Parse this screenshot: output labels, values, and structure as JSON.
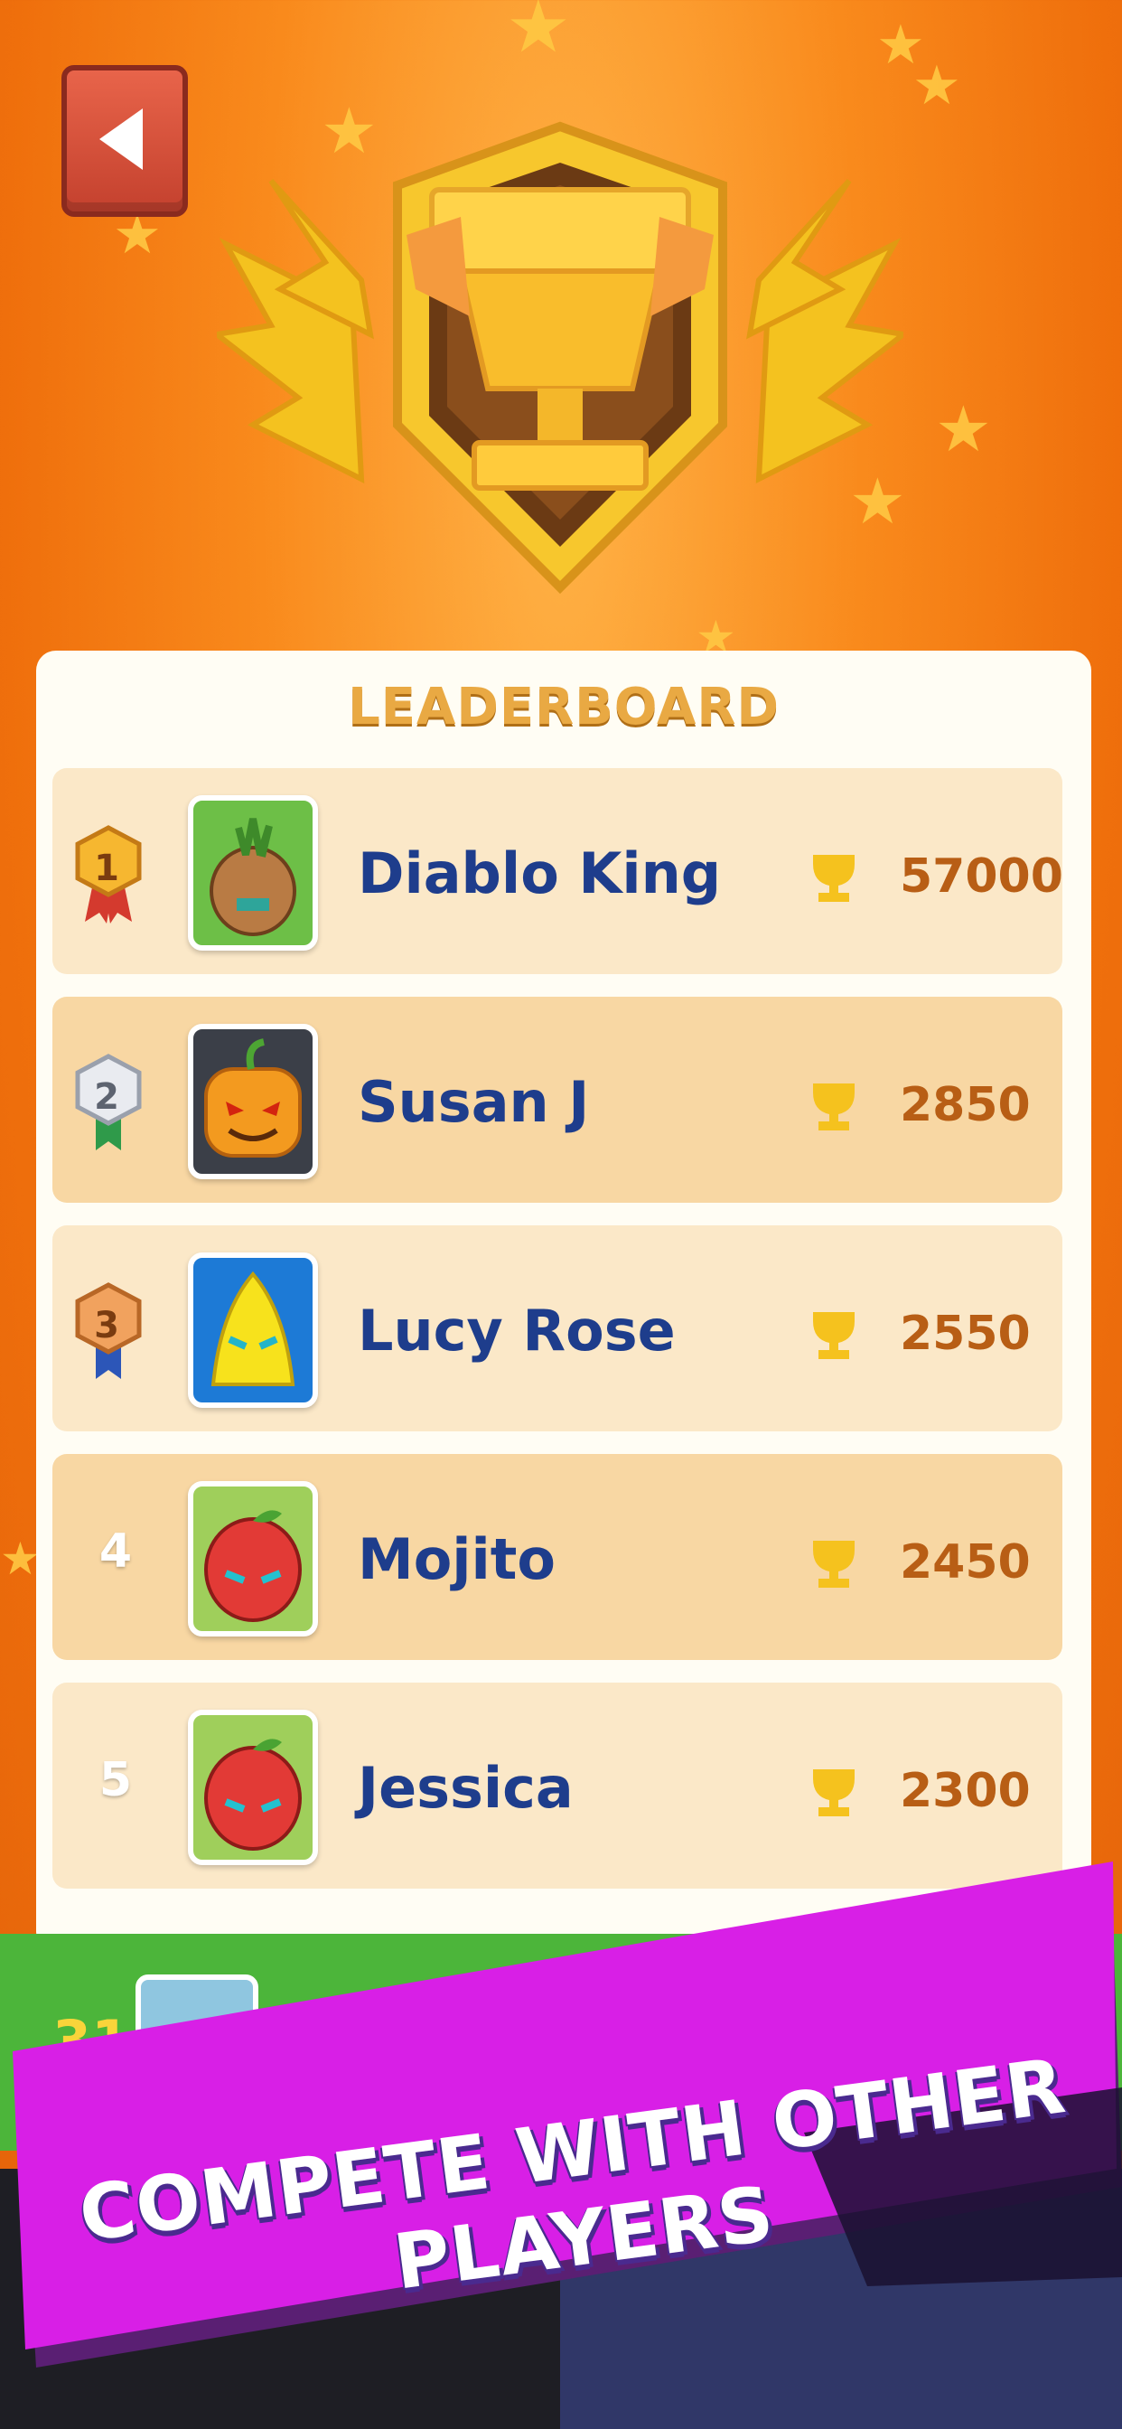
{
  "leaderboard": {
    "title": "LEADERBOARD",
    "players": [
      {
        "rank": "1",
        "name": "Diablo King",
        "score": "57000",
        "avatar": "onion-character"
      },
      {
        "rank": "2",
        "name": "Susan J",
        "score": "2850",
        "avatar": "pumpkin-character"
      },
      {
        "rank": "3",
        "name": "Lucy Rose",
        "score": "2550",
        "avatar": "banana-character"
      },
      {
        "rank": "4",
        "name": "Mojito",
        "score": "2450",
        "avatar": "apple-character"
      },
      {
        "rank": "5",
        "name": "Jessica",
        "score": "2300",
        "avatar": "apple-character"
      }
    ]
  },
  "user_row": {
    "rank": "31"
  },
  "banner": {
    "text": "COMPETE WITH OTHER PLAYERS"
  },
  "colors": {
    "background": "#ef6f0c",
    "name_text": "#1e3d8c",
    "score_text": "#b85e15",
    "banner": "#d81fe6"
  },
  "icons": [
    "back-arrow-icon",
    "trophy-emblem",
    "trophy-icon",
    "rank-medal-icon"
  ]
}
